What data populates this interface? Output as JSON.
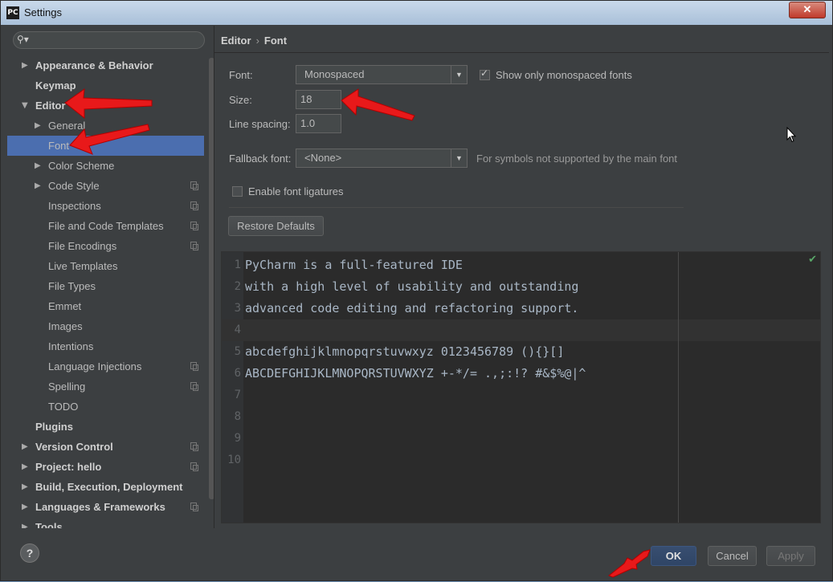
{
  "window": {
    "title": "Settings",
    "app_icon": "PC"
  },
  "search": {
    "placeholder": ""
  },
  "breadcrumb": {
    "parent": "Editor",
    "current": "Font"
  },
  "sidebar": {
    "items": [
      {
        "label": "Appearance & Behavior",
        "level": 0,
        "expanded": false,
        "arrow": true
      },
      {
        "label": "Keymap",
        "level": 0,
        "arrow": false
      },
      {
        "label": "Editor",
        "level": 0,
        "expanded": true,
        "arrow": true
      },
      {
        "label": "General",
        "level": 1,
        "arrow": true
      },
      {
        "label": "Font",
        "level": 1,
        "arrow": false,
        "selected": true
      },
      {
        "label": "Color Scheme",
        "level": 1,
        "arrow": true
      },
      {
        "label": "Code Style",
        "level": 1,
        "arrow": true,
        "copy": true
      },
      {
        "label": "Inspections",
        "level": 1,
        "copy": true
      },
      {
        "label": "File and Code Templates",
        "level": 1,
        "copy": true
      },
      {
        "label": "File Encodings",
        "level": 1,
        "copy": true
      },
      {
        "label": "Live Templates",
        "level": 1
      },
      {
        "label": "File Types",
        "level": 1
      },
      {
        "label": "Emmet",
        "level": 1
      },
      {
        "label": "Images",
        "level": 1
      },
      {
        "label": "Intentions",
        "level": 1
      },
      {
        "label": "Language Injections",
        "level": 1,
        "copy": true
      },
      {
        "label": "Spelling",
        "level": 1,
        "copy": true
      },
      {
        "label": "TODO",
        "level": 1
      },
      {
        "label": "Plugins",
        "level": 0,
        "arrow": false
      },
      {
        "label": "Version Control",
        "level": 0,
        "arrow": true,
        "copy": true
      },
      {
        "label": "Project: hello",
        "level": 0,
        "arrow": true,
        "copy": true
      },
      {
        "label": "Build, Execution, Deployment",
        "level": 0,
        "arrow": true
      },
      {
        "label": "Languages & Frameworks",
        "level": 0,
        "arrow": true,
        "copy": true
      },
      {
        "label": "Tools",
        "level": 0,
        "arrow": true
      }
    ]
  },
  "font": {
    "font_label": "Font:",
    "font_value": "Monospaced",
    "show_mono_label": "Show only monospaced fonts",
    "show_mono_checked": true,
    "size_label": "Size:",
    "size_value": "18",
    "spacing_label": "Line spacing:",
    "spacing_value": "1.0",
    "fallback_label": "Fallback font:",
    "fallback_value": "<None>",
    "fallback_hint": "For symbols not supported by the main font",
    "ligatures_label": "Enable font ligatures",
    "ligatures_checked": false,
    "restore_label": "Restore Defaults"
  },
  "preview": {
    "lines": [
      "PyCharm is a full-featured IDE",
      "with a high level of usability and outstanding",
      "advanced code editing and refactoring support.",
      "",
      "abcdefghijklmnopqrstuvwxyz 0123456789 (){}[]",
      "ABCDEFGHIJKLMNOPQRSTUVWXYZ +-*/= .,;:!? #&$%@|^",
      "",
      "",
      "",
      ""
    ],
    "line_numbers": [
      "1",
      "2",
      "3",
      "4",
      "5",
      "6",
      "7",
      "8",
      "9",
      "10"
    ]
  },
  "footer": {
    "help": "?",
    "ok": "OK",
    "cancel": "Cancel",
    "apply": "Apply"
  },
  "colors": {
    "background": "#3c3f41",
    "selection": "#4b6eaf",
    "editor_bg": "#2b2b2b",
    "annotation_arrow": "#e8191a"
  }
}
